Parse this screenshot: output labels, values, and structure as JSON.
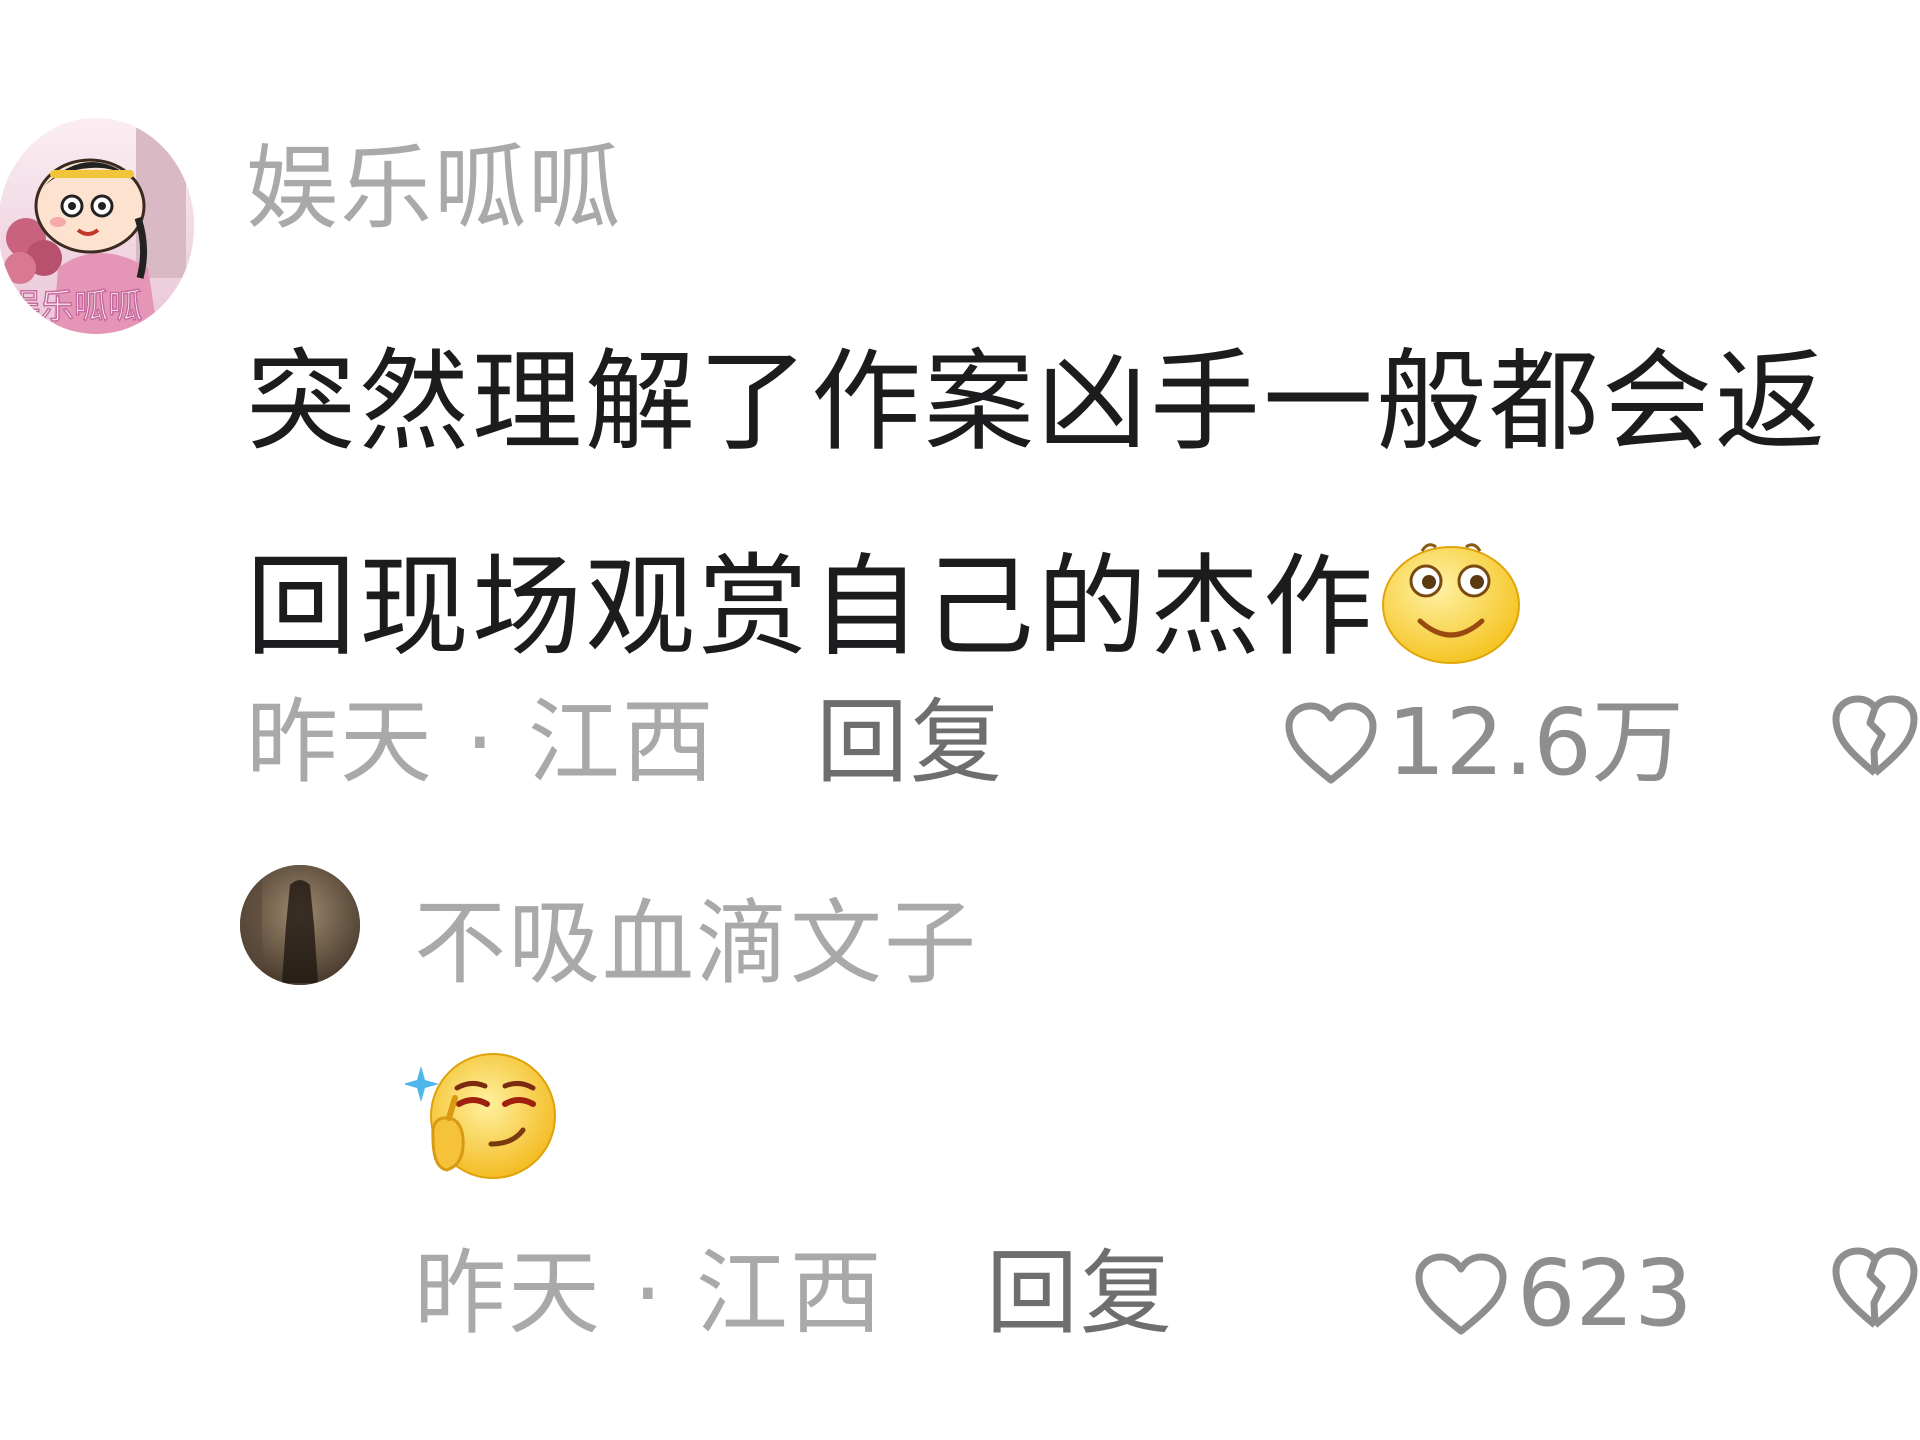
{
  "main_comment": {
    "username": "娱乐呱呱",
    "avatar_text": "娱乐呱呱",
    "text": "突然理解了作案凶手一般都会返回现场观赏自己的杰作",
    "inline_emoji": "smile-emoji",
    "meta": "昨天 · 江西",
    "reply_label": "回复",
    "like_count": "12.6万"
  },
  "reply_comment": {
    "username": "不吸血滴文子",
    "sticker": "thinking-smirk-emoji",
    "meta": "昨天 · 江西",
    "reply_label": "回复",
    "like_count": "623"
  },
  "icons": {
    "like": "heart-outline-icon",
    "dislike": "broken-heart-icon"
  },
  "colors": {
    "text_primary": "#1c1c1e",
    "text_secondary": "#a9a9a9",
    "reply_label": "#6e6e6e"
  }
}
